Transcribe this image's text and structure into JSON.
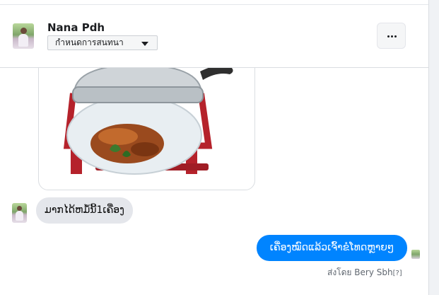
{
  "header": {
    "name": "Nana Pdh",
    "conversation_button": "กำหนดการสนทนา",
    "more_button": "..."
  },
  "messages": {
    "incoming_text": "ມາກໄດ້ຫມໍ້ນີ້1ເຄື່ອງ",
    "outgoing_text": "ເຄື່ອງໝົດແລ້ວເຈົ້າຂໍໂທດຫຼາຍໆ",
    "sent_by_prefix": "ส่งโดย",
    "sent_by_name": "Bery Sbh",
    "sent_by_help": "[?]"
  },
  "colors": {
    "outgoing_bubble": "#0084ff",
    "incoming_bubble": "#e4e6eb",
    "text_primary": "#1c1e21"
  },
  "icons": {
    "dropdown": "caret-down-icon",
    "more": "ellipsis-icon"
  }
}
